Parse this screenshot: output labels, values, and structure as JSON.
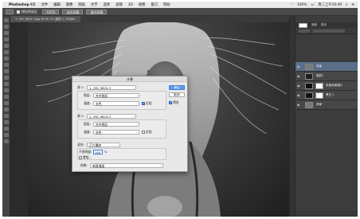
{
  "menubar": {
    "app_name": "Photoshop CC",
    "items": [
      "文件",
      "编辑",
      "图像",
      "图层",
      "文字",
      "选择",
      "滤镜",
      "3D",
      "视图",
      "窗口",
      "帮助"
    ],
    "status": {
      "battery": "100%",
      "clock": "周二上午10:49"
    }
  },
  "options_bar": {
    "checkbox_label": "增加到选区",
    "zoom": "100%",
    "btn_fit": "适合屏幕",
    "btn_fill": "填充屏幕"
  },
  "tab": {
    "label": "1._MG_9824-3.jpg @ 66.7% (图层 1, RGB/8)"
  },
  "right_panel": {
    "tabs": [
      "图层",
      "通道",
      "路径"
    ],
    "layers": [
      {
        "name": "背景",
        "thumb": "gray",
        "active": true
      },
      {
        "name": "图层1",
        "thumb": "dark",
        "active": false
      },
      {
        "name": "色相/饱和度1",
        "thumb": "blk",
        "mask": true,
        "active": false
      },
      {
        "name": "黑白 1",
        "thumb": "blk",
        "mask": true,
        "active": false
      },
      {
        "name": "背景",
        "thumb": "gray",
        "active": false
      }
    ]
  },
  "dialog": {
    "title": "计算",
    "source1": {
      "label": "源 1:",
      "file": "1._MG_9824-3",
      "layer_label": "图层:",
      "layer": "合并图层",
      "channel_label": "通道:",
      "channel": "灰色",
      "invert_label": "反相",
      "invert": true
    },
    "source2": {
      "label": "源 2:",
      "file": "1._MG_9824-3",
      "layer_label": "图层:",
      "layer": "合并图层",
      "channel_label": "通道:",
      "channel": "灰色",
      "invert_label": "反相",
      "invert": false
    },
    "blending": {
      "label": "混合:",
      "mode": "正片叠底",
      "opacity_label": "不透明度:",
      "opacity": "100",
      "opacity_unit": "%",
      "mask_label": "蒙版..."
    },
    "result": {
      "label": "结果:",
      "value": "新建通道"
    },
    "buttons": {
      "ok": "确定",
      "cancel": "取消",
      "preview": "预览",
      "preview_checked": true
    }
  }
}
